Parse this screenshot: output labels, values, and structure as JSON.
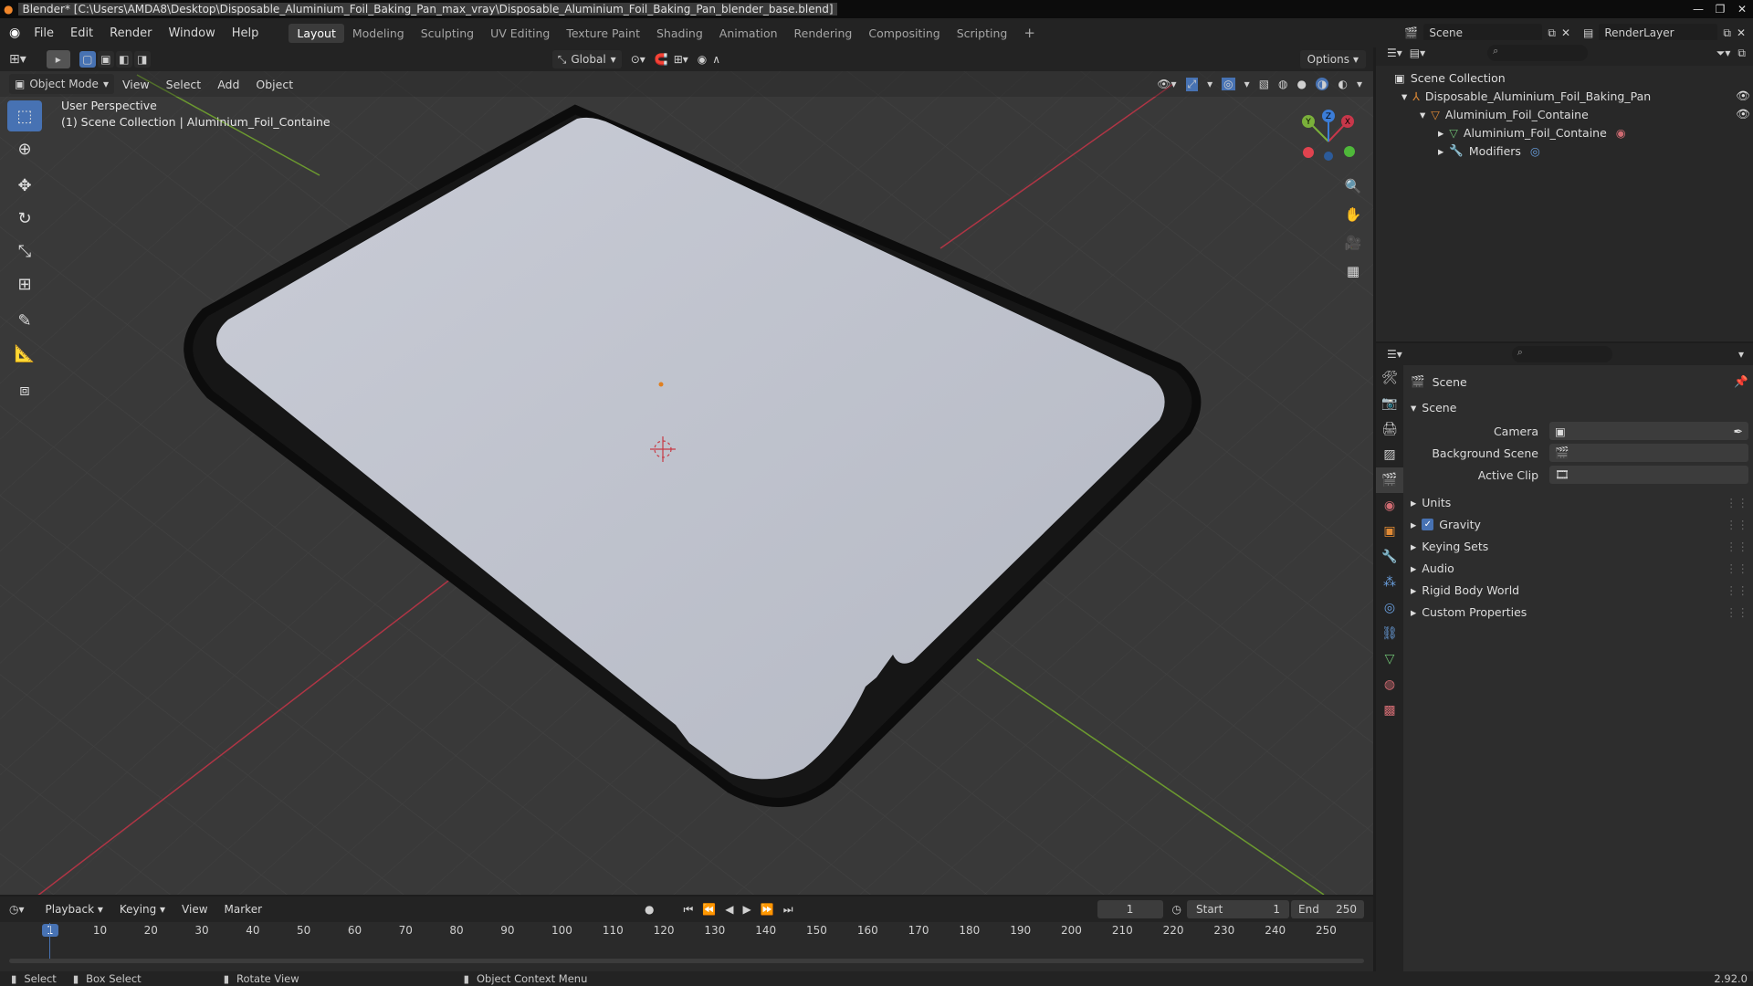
{
  "titlebar": {
    "title": "Blender* [C:\\Users\\AMDA8\\Desktop\\Disposable_Aluminium_Foil_Baking_Pan_max_vray\\Disposable_Aluminium_Foil_Baking_Pan_blender_base.blend]"
  },
  "menu": [
    "File",
    "Edit",
    "Render",
    "Window",
    "Help"
  ],
  "workspaces": [
    "Layout",
    "Modeling",
    "Sculpting",
    "UV Editing",
    "Texture Paint",
    "Shading",
    "Animation",
    "Rendering",
    "Compositing",
    "Scripting"
  ],
  "scene": {
    "name": "Scene",
    "renderlayer": "RenderLayer"
  },
  "viewport": {
    "orientation": "Global",
    "options": "Options",
    "mode": "Object Mode",
    "menu": [
      "View",
      "Select",
      "Add",
      "Object"
    ],
    "perspective": "User Perspective",
    "collection_info": "(1) Scene Collection | Aluminium_Foil_Containe"
  },
  "outliner": {
    "root": "Scene Collection",
    "items": [
      "Disposable_Aluminium_Foil_Baking_Pan",
      "Aluminium_Foil_Containe",
      "Aluminium_Foil_Containe",
      "Modifiers"
    ]
  },
  "properties": {
    "header": "Scene",
    "section": "Scene",
    "camera_label": "Camera",
    "bg_label": "Background Scene",
    "clip_label": "Active Clip",
    "panels": [
      "Units",
      "Gravity",
      "Keying Sets",
      "Audio",
      "Rigid Body World",
      "Custom Properties"
    ],
    "gravity_checked": true
  },
  "timeline": {
    "menu": [
      "Playback",
      "Keying",
      "View",
      "Marker"
    ],
    "current": "1",
    "start_label": "Start",
    "start": "1",
    "end_label": "End",
    "end": "250",
    "ticks": [
      "1",
      "10",
      "20",
      "30",
      "40",
      "50",
      "60",
      "70",
      "80",
      "90",
      "100",
      "110",
      "120",
      "130",
      "140",
      "150",
      "160",
      "170",
      "180",
      "190",
      "200",
      "210",
      "220",
      "230",
      "240",
      "250"
    ]
  },
  "status": {
    "select": "Select",
    "box_select": "Box Select",
    "rotate": "Rotate View",
    "context": "Object Context Menu",
    "version": "2.92.0"
  },
  "colors": {
    "accent": "#4772b3",
    "x_axis": "#c8374a",
    "y_axis": "#7ab03a",
    "z_axis": "#3b7dd8"
  }
}
